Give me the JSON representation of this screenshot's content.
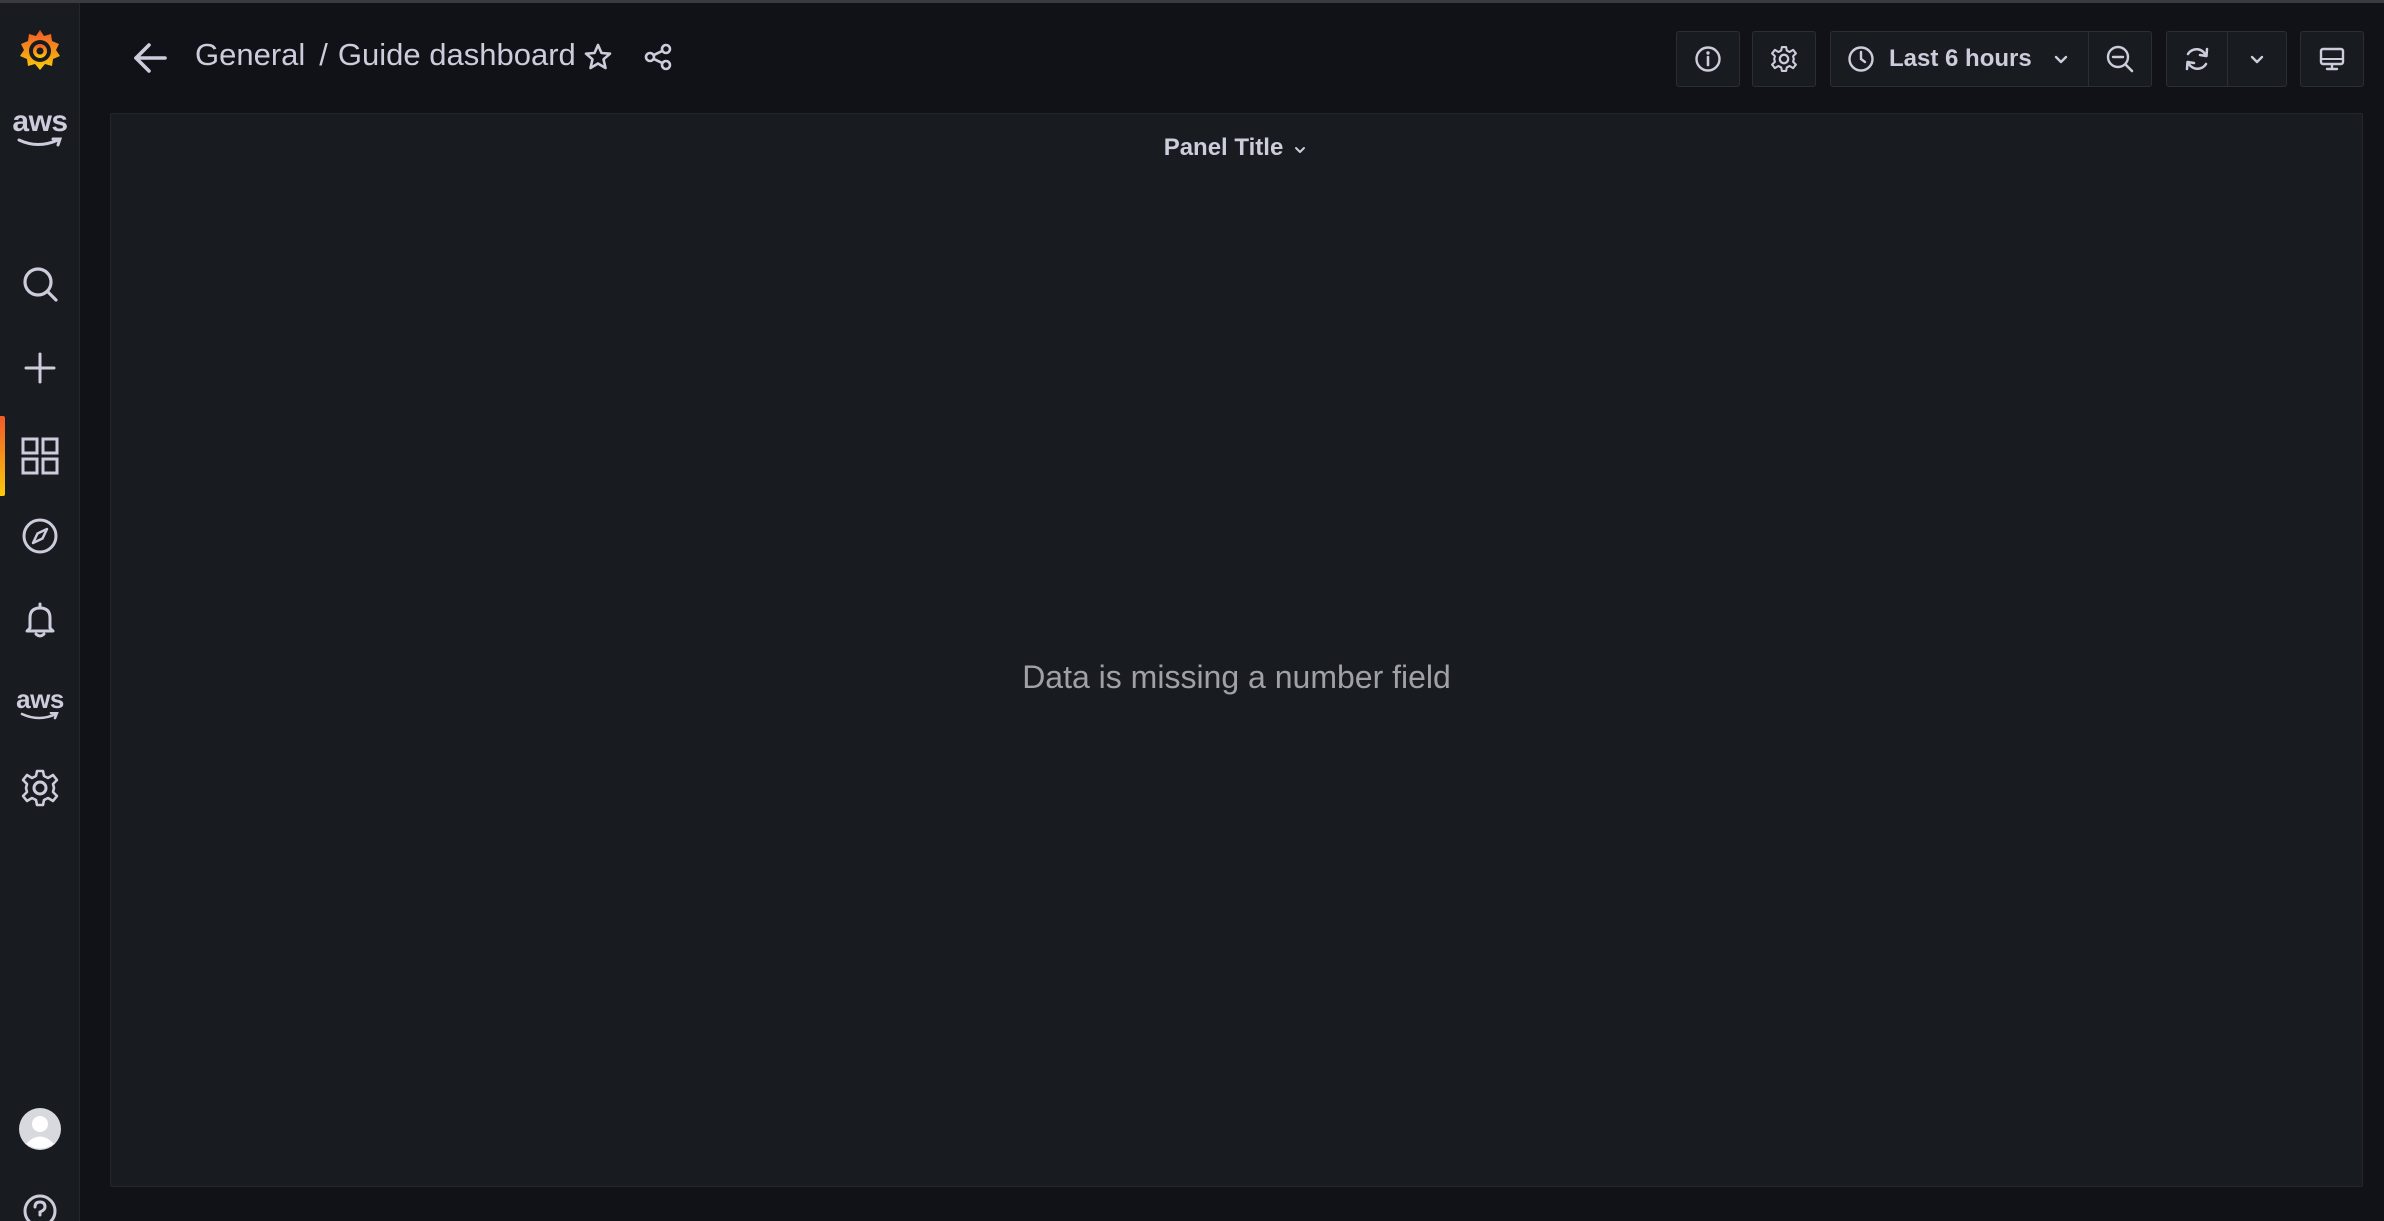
{
  "sidemenu": {
    "logo_icon": "grafana-logo",
    "items": [
      {
        "name": "aws-logo",
        "label": "aws"
      },
      {
        "name": "search-icon"
      },
      {
        "name": "plus-icon"
      },
      {
        "name": "dashboards-icon",
        "active": true
      },
      {
        "name": "explore-compass-icon"
      },
      {
        "name": "alerting-bell-icon"
      },
      {
        "name": "aws-services",
        "label": "aws"
      },
      {
        "name": "gear-icon"
      },
      {
        "name": "avatar"
      },
      {
        "name": "help-icon"
      }
    ],
    "active_accent": "#f05a28"
  },
  "navbar": {
    "folder": "General",
    "separator": "/",
    "dashboard_title": "Guide dashboard",
    "time_range": "Last 6 hours"
  },
  "panel": {
    "title": "Panel Title",
    "message": "Data is missing a number field"
  },
  "colors": {
    "background": "#111217",
    "panel": "#181b1f",
    "text": "#ccccdc",
    "muted": "#9fa1a7"
  }
}
